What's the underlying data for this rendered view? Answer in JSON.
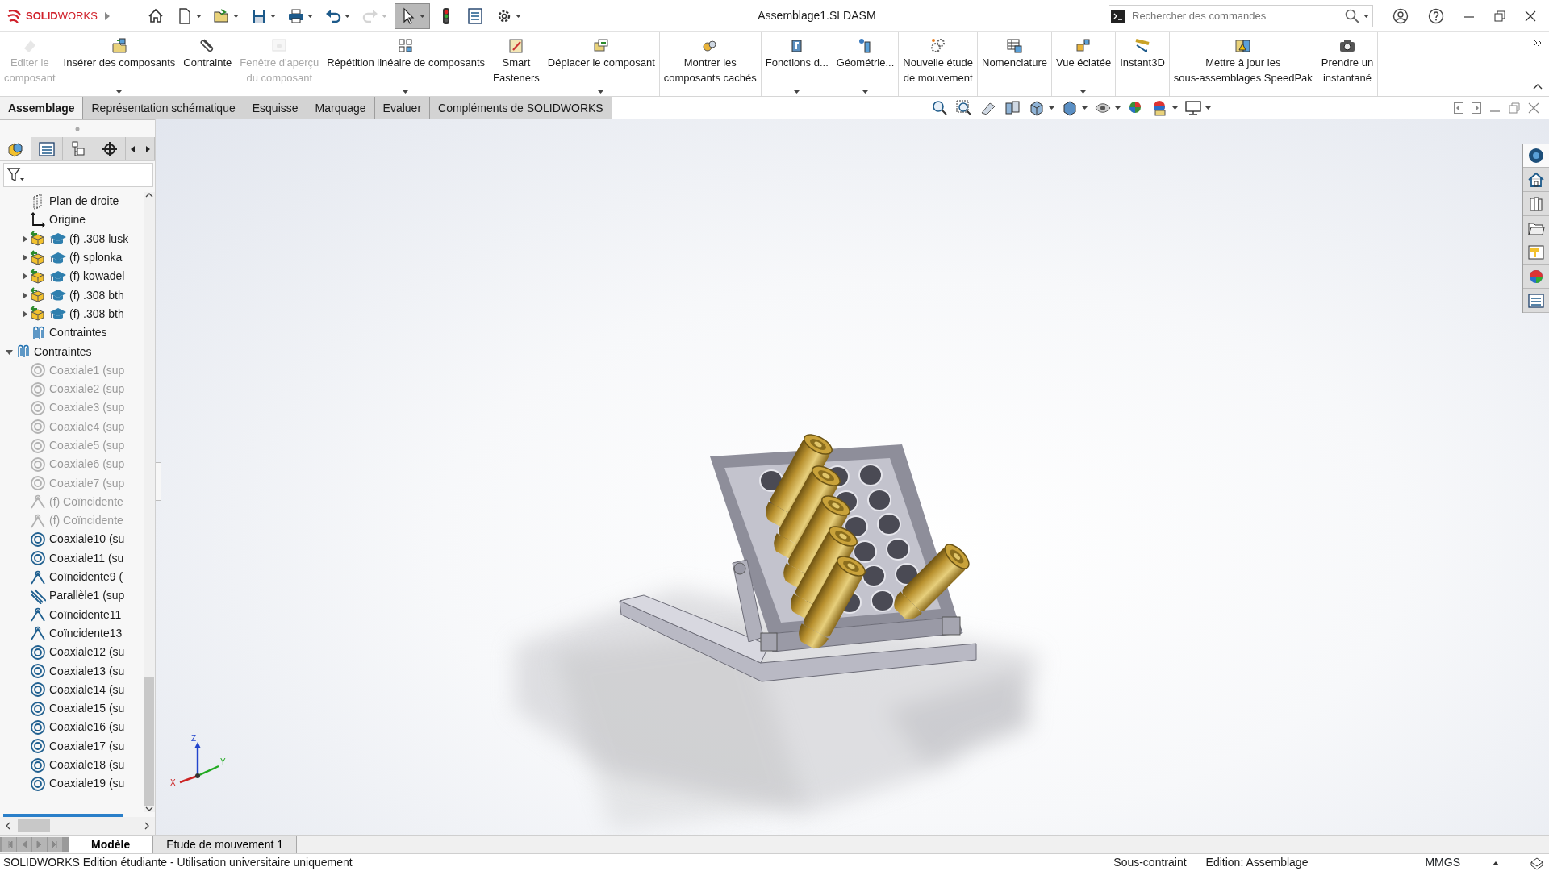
{
  "app": {
    "logo": "**SOLID**WORKS",
    "title": "Assemblage1.SLDASM"
  },
  "quick_access": [
    {
      "kind": "home",
      "dropdown": false,
      "disabled": false,
      "selected": false
    },
    {
      "kind": "new",
      "dropdown": true,
      "disabled": false,
      "selected": false
    },
    {
      "kind": "open",
      "dropdown": true,
      "disabled": false,
      "selected": false
    },
    {
      "kind": "save",
      "dropdown": true,
      "disabled": false,
      "selected": false
    },
    {
      "kind": "print",
      "dropdown": true,
      "disabled": false,
      "selected": false
    },
    {
      "kind": "undo",
      "dropdown": true,
      "disabled": false,
      "selected": false
    },
    {
      "kind": "redo",
      "dropdown": true,
      "disabled": true,
      "selected": false
    },
    {
      "kind": "select",
      "dropdown": true,
      "disabled": false,
      "selected": true
    },
    {
      "kind": "rebuild",
      "dropdown": false,
      "disabled": false,
      "selected": false
    },
    {
      "kind": "properties",
      "dropdown": false,
      "disabled": false,
      "selected": false
    },
    {
      "kind": "options",
      "dropdown": true,
      "disabled": false,
      "selected": false
    }
  ],
  "search": {
    "placeholder": "Rechercher des commandes"
  },
  "ribbon_groups": [
    [
      {
        "label": "Editer le\ncomposant",
        "disabled": true,
        "dropdown": false
      },
      {
        "label": "Insérer des composants",
        "disabled": false,
        "dropdown": true
      },
      {
        "label": "Contrainte",
        "disabled": false,
        "dropdown": false
      },
      {
        "label": "Fenêtre d'aperçu\ndu composant",
        "disabled": true,
        "dropdown": false
      },
      {
        "label": "Répétition linéaire de composants",
        "disabled": false,
        "dropdown": true
      },
      {
        "label": "Smart\nFasteners",
        "disabled": false,
        "dropdown": false
      },
      {
        "label": "Déplacer le composant",
        "disabled": false,
        "dropdown": true
      }
    ],
    [
      {
        "label": "Montrer les\ncomposants cachés",
        "disabled": false,
        "dropdown": false
      }
    ],
    [
      {
        "label": "Fonctions d...",
        "disabled": false,
        "dropdown": true
      },
      {
        "label": "Géométrie...",
        "disabled": false,
        "dropdown": true
      }
    ],
    [
      {
        "label": "Nouvelle étude\nde mouvement",
        "disabled": false,
        "dropdown": false
      }
    ],
    [
      {
        "label": "Nomenclature",
        "disabled": false,
        "dropdown": false
      }
    ],
    [
      {
        "label": "Vue éclatée",
        "disabled": false,
        "dropdown": true
      }
    ],
    [
      {
        "label": "Instant3D",
        "disabled": false,
        "dropdown": false
      }
    ],
    [
      {
        "label": "Mettre à jour les\nsous-assemblages SpeedPak",
        "disabled": false,
        "dropdown": false
      }
    ],
    [
      {
        "label": "Prendre un\ninstantané",
        "disabled": false,
        "dropdown": false
      }
    ]
  ],
  "command_tabs": [
    {
      "label": "Assemblage",
      "selected": true
    },
    {
      "label": "Représentation schématique",
      "selected": false
    },
    {
      "label": "Esquisse",
      "selected": false
    },
    {
      "label": "Marquage",
      "selected": false
    },
    {
      "label": "Evaluer",
      "selected": false
    },
    {
      "label": "Compléments de SOLIDWORKS",
      "selected": false
    }
  ],
  "panel_tabs": [
    {
      "kind": "feature-tree",
      "selected": true
    },
    {
      "kind": "properties",
      "selected": false
    },
    {
      "kind": "configurations",
      "selected": false
    },
    {
      "kind": "dimxpert",
      "selected": false
    }
  ],
  "tree": [
    {
      "label": "Plan de droite",
      "kind": "plane",
      "disabled": false
    },
    {
      "label": "Origine",
      "kind": "origin",
      "disabled": false
    },
    {
      "label": "(f) .308 lusk",
      "kind": "part",
      "disabled": false,
      "expanded": false
    },
    {
      "label": "(f) splonka",
      "kind": "part",
      "disabled": false,
      "expanded": false
    },
    {
      "label": "(f) kowadel",
      "kind": "part",
      "disabled": false,
      "expanded": false
    },
    {
      "label": "(f) .308 bth",
      "kind": "part",
      "disabled": false,
      "expanded": false
    },
    {
      "label": "(f) .308 bth",
      "kind": "part",
      "disabled": false,
      "expanded": false
    },
    {
      "label": "Contraintes",
      "kind": "mates",
      "disabled": false
    },
    {
      "label": "Contraintes",
      "kind": "mates",
      "disabled": false,
      "expanded": true,
      "children": [
        {
          "label": "Coaxiale1 (sup",
          "kind": "coaxial",
          "disabled": true
        },
        {
          "label": "Coaxiale2 (sup",
          "kind": "coaxial",
          "disabled": true
        },
        {
          "label": "Coaxiale3 (sup",
          "kind": "coaxial",
          "disabled": true
        },
        {
          "label": "Coaxiale4 (sup",
          "kind": "coaxial",
          "disabled": true
        },
        {
          "label": "Coaxiale5 (sup",
          "kind": "coaxial",
          "disabled": true
        },
        {
          "label": "Coaxiale6 (sup",
          "kind": "coaxial",
          "disabled": true
        },
        {
          "label": "Coaxiale7 (sup",
          "kind": "coaxial",
          "disabled": true
        },
        {
          "label": "(f) Coïncidente",
          "kind": "coincident",
          "disabled": true
        },
        {
          "label": "(f) Coïncidente",
          "kind": "coincident",
          "disabled": true
        },
        {
          "label": "Coaxiale10 (su",
          "kind": "coaxial",
          "disabled": false
        },
        {
          "label": "Coaxiale11 (su",
          "kind": "coaxial",
          "disabled": false
        },
        {
          "label": "Coïncidente9 (",
          "kind": "coincident",
          "disabled": false
        },
        {
          "label": "Parallèle1 (sup",
          "kind": "parallel",
          "disabled": false
        },
        {
          "label": "Coïncidente11",
          "kind": "coincident",
          "disabled": false
        },
        {
          "label": "Coïncidente13",
          "kind": "coincident",
          "disabled": false
        },
        {
          "label": "Coaxiale12 (su",
          "kind": "coaxial",
          "disabled": false
        },
        {
          "label": "Coaxiale13 (su",
          "kind": "coaxial",
          "disabled": false
        },
        {
          "label": "Coaxiale14 (su",
          "kind": "coaxial",
          "disabled": false
        },
        {
          "label": "Coaxiale15 (su",
          "kind": "coaxial",
          "disabled": false
        },
        {
          "label": "Coaxiale16 (su",
          "kind": "coaxial",
          "disabled": false
        },
        {
          "label": "Coaxiale17 (su",
          "kind": "coaxial",
          "disabled": false
        },
        {
          "label": "Coaxiale18 (su",
          "kind": "coaxial",
          "disabled": false
        },
        {
          "label": "Coaxiale19 (su",
          "kind": "coaxial",
          "disabled": false
        }
      ]
    }
  ],
  "triad": {
    "z": "Z",
    "y": "Y",
    "x": "X"
  },
  "task_pane": [
    {
      "kind": "resources",
      "selected": true
    },
    {
      "kind": "home",
      "selected": false
    },
    {
      "kind": "library",
      "selected": false
    },
    {
      "kind": "folder",
      "selected": false
    },
    {
      "kind": "palette",
      "selected": false
    },
    {
      "kind": "appearances",
      "selected": false
    },
    {
      "kind": "properties",
      "selected": false
    }
  ],
  "bottom_tabs": [
    {
      "label": "Modèle",
      "selected": true
    },
    {
      "label": "Etude de mouvement 1",
      "selected": false
    }
  ],
  "status_bar": {
    "edition": "SOLIDWORKS Edition étudiante - Utilisation universitaire uniquement",
    "constraint": "Sous-contraint",
    "mode": "Edition: Assemblage",
    "units": "MMGS"
  }
}
